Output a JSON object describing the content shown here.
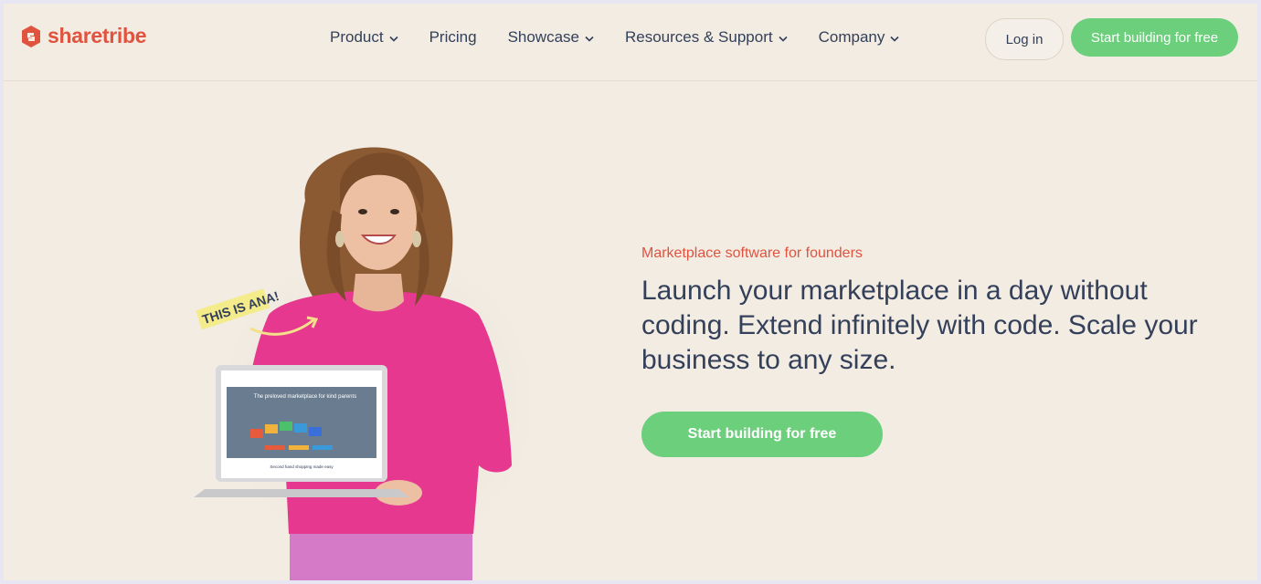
{
  "brand": {
    "name": "sharetribe",
    "color": "#e0533f",
    "icon": "sharetribe-logo-icon"
  },
  "nav": {
    "items": [
      {
        "label": "Product",
        "has_dropdown": true
      },
      {
        "label": "Pricing",
        "has_dropdown": false
      },
      {
        "label": "Showcase",
        "has_dropdown": true
      },
      {
        "label": "Resources & Support",
        "has_dropdown": true
      },
      {
        "label": "Company",
        "has_dropdown": true
      }
    ]
  },
  "header": {
    "login_label": "Log in",
    "cta_label": "Start building for free"
  },
  "hero": {
    "eyebrow": "Marketplace software for founders",
    "headline": "Launch your marketplace in a day without coding. Extend infinitely with code. Scale your business to any size.",
    "cta_label": "Start building for free",
    "photo_caption": "THIS IS ANA!",
    "laptop_screen": {
      "headline": "The preloved marketplace for kind parents",
      "tagline": "Second hand shopping made easy"
    }
  },
  "colors": {
    "accent_red": "#e0533f",
    "cta_green": "#6ccf7c",
    "text_dark": "#34405a",
    "background": "#f2ece3",
    "sweater_pink": "#e6388e"
  }
}
